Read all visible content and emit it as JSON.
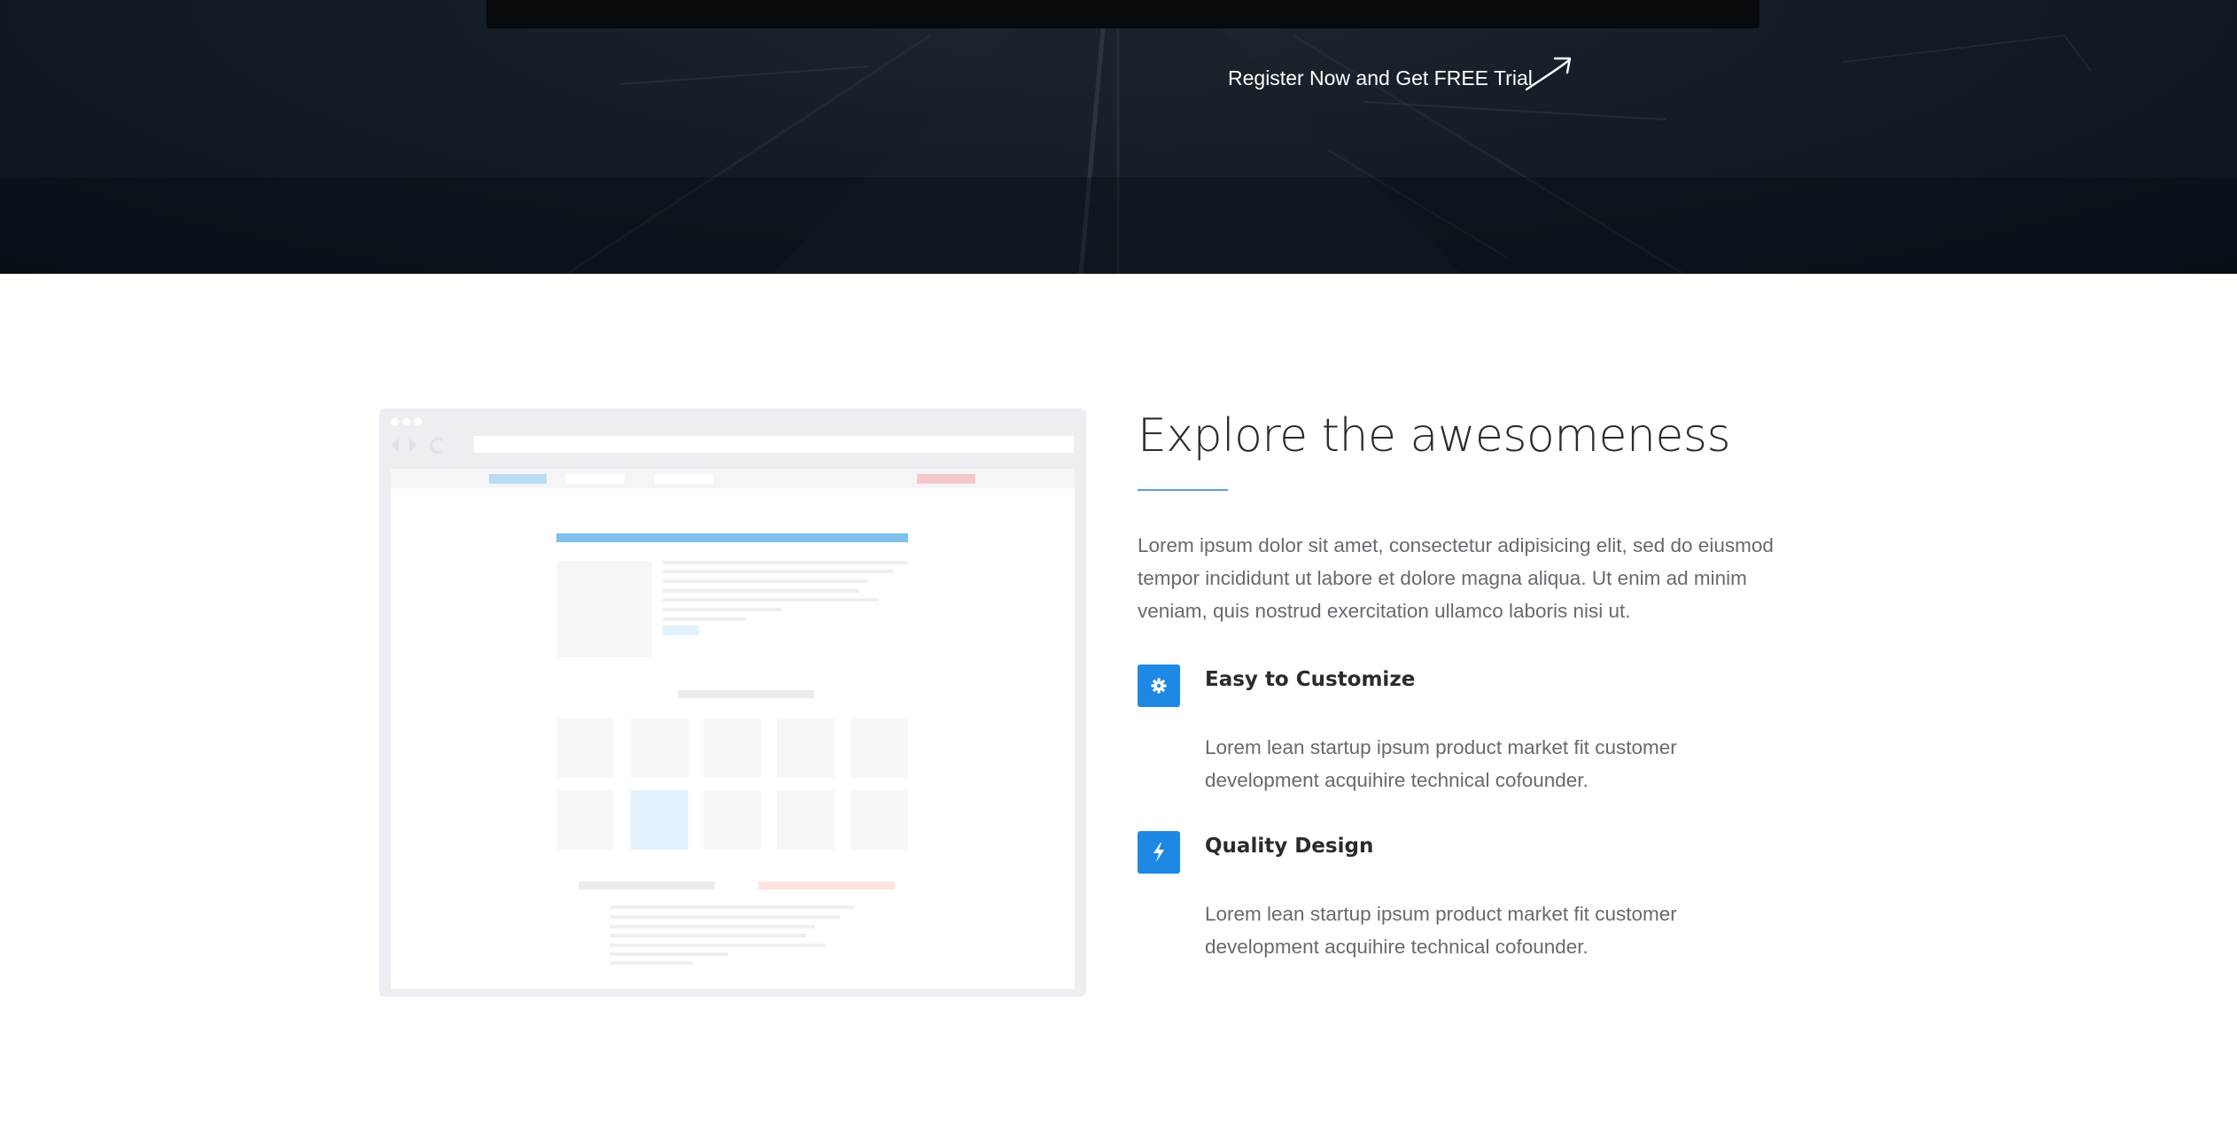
{
  "hero": {
    "cta_text": "Register Now and Get FREE Trial",
    "cta_icon": "hand-drawn-arrow-icon"
  },
  "features_section": {
    "heading": "Explore the awesomeness",
    "intro": "Lorem ipsum dolor sit amet, consectetur adipisicing elit, sed do eiusmod tempor incididunt ut labore et dolore magna aliqua. Ut enim ad minim veniam, quis nostrud exercitation ullamco laboris nisi ut.",
    "accent_color": "#1e88e5",
    "illustration": "browser-wireframe-illustration",
    "items": [
      {
        "icon": "gear-icon",
        "title": "Easy to Customize",
        "description": "Lorem lean startup ipsum product market fit customer development acquihire technical cofounder."
      },
      {
        "icon": "lightning-bolt-icon",
        "title": "Quality Design",
        "description": "Lorem lean startup ipsum product market fit customer development acquihire technical cofounder."
      }
    ]
  }
}
